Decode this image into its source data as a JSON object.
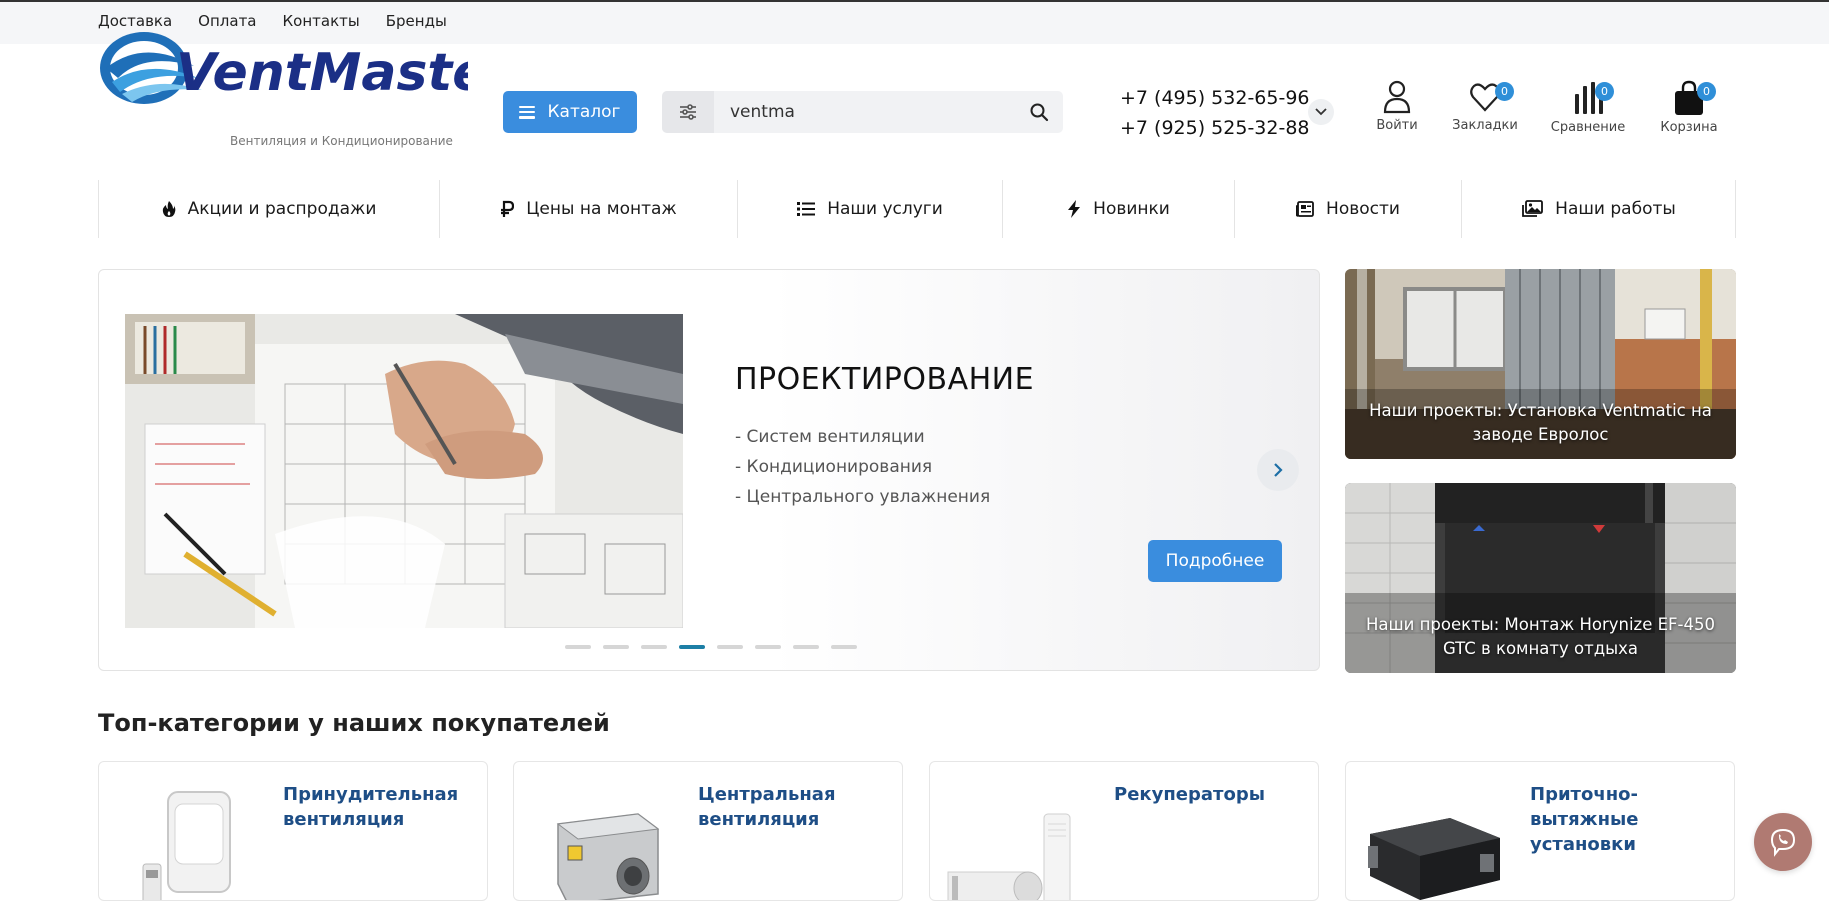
{
  "topbar": {
    "links": [
      "Доставка",
      "Оплата",
      "Контакты",
      "Бренды"
    ]
  },
  "header": {
    "logo_text": "VentMaster+",
    "logo_subtitle": "Вентиляция и Кондиционирование",
    "catalog_label": "Каталог",
    "search_value": "ventma",
    "phones": [
      "+7 (495) 532-65-96",
      "+7 (925) 525-32-88"
    ],
    "icons": [
      {
        "label": "Войти",
        "icon": "user-icon"
      },
      {
        "label": "Закладки",
        "icon": "heart-icon",
        "count": "0"
      },
      {
        "label": "Сравнение",
        "icon": "compare-icon",
        "count": "0"
      },
      {
        "label": "Корзина",
        "icon": "bag-icon",
        "count": "0"
      }
    ]
  },
  "nav": [
    {
      "label": "Акции и распродажи",
      "icon": "fire-icon"
    },
    {
      "label": "Цены на монтаж",
      "icon": "ruble-icon"
    },
    {
      "label": "Наши услуги",
      "icon": "list-icon"
    },
    {
      "label": "Новинки",
      "icon": "bolt-icon"
    },
    {
      "label": "Новости",
      "icon": "newspaper-icon"
    },
    {
      "label": "Наши работы",
      "icon": "images-icon"
    }
  ],
  "slider": {
    "title": "ПРОЕКТИРОВАНИЕ",
    "lines": [
      "- Систем вентиляции",
      "- Кондиционирования",
      "- Центрального увлажнения"
    ],
    "button": "Подробнее",
    "dots_count": 8,
    "active_dot": 4
  },
  "promos": [
    {
      "caption": "Наши проекты: Установка Ventmatic на заводе Евролос"
    },
    {
      "caption": "Наши проекты: Монтаж Horynize EF-450 GTC в комнату отдыха"
    }
  ],
  "top_categories": {
    "title": "Топ-категории у наших покупателей",
    "items": [
      {
        "name": "Принудительная вентиляция"
      },
      {
        "name": "Центральная вентиляция"
      },
      {
        "name": "Рекуператоры"
      },
      {
        "name": "Приточно-вытяжные установки"
      }
    ]
  },
  "colors": {
    "accent": "#3a8dde",
    "badge": "#2f8fd8",
    "category_link": "#1e4e86",
    "slider_dot_active": "#1d7fa6",
    "viber": "#b07a72"
  }
}
